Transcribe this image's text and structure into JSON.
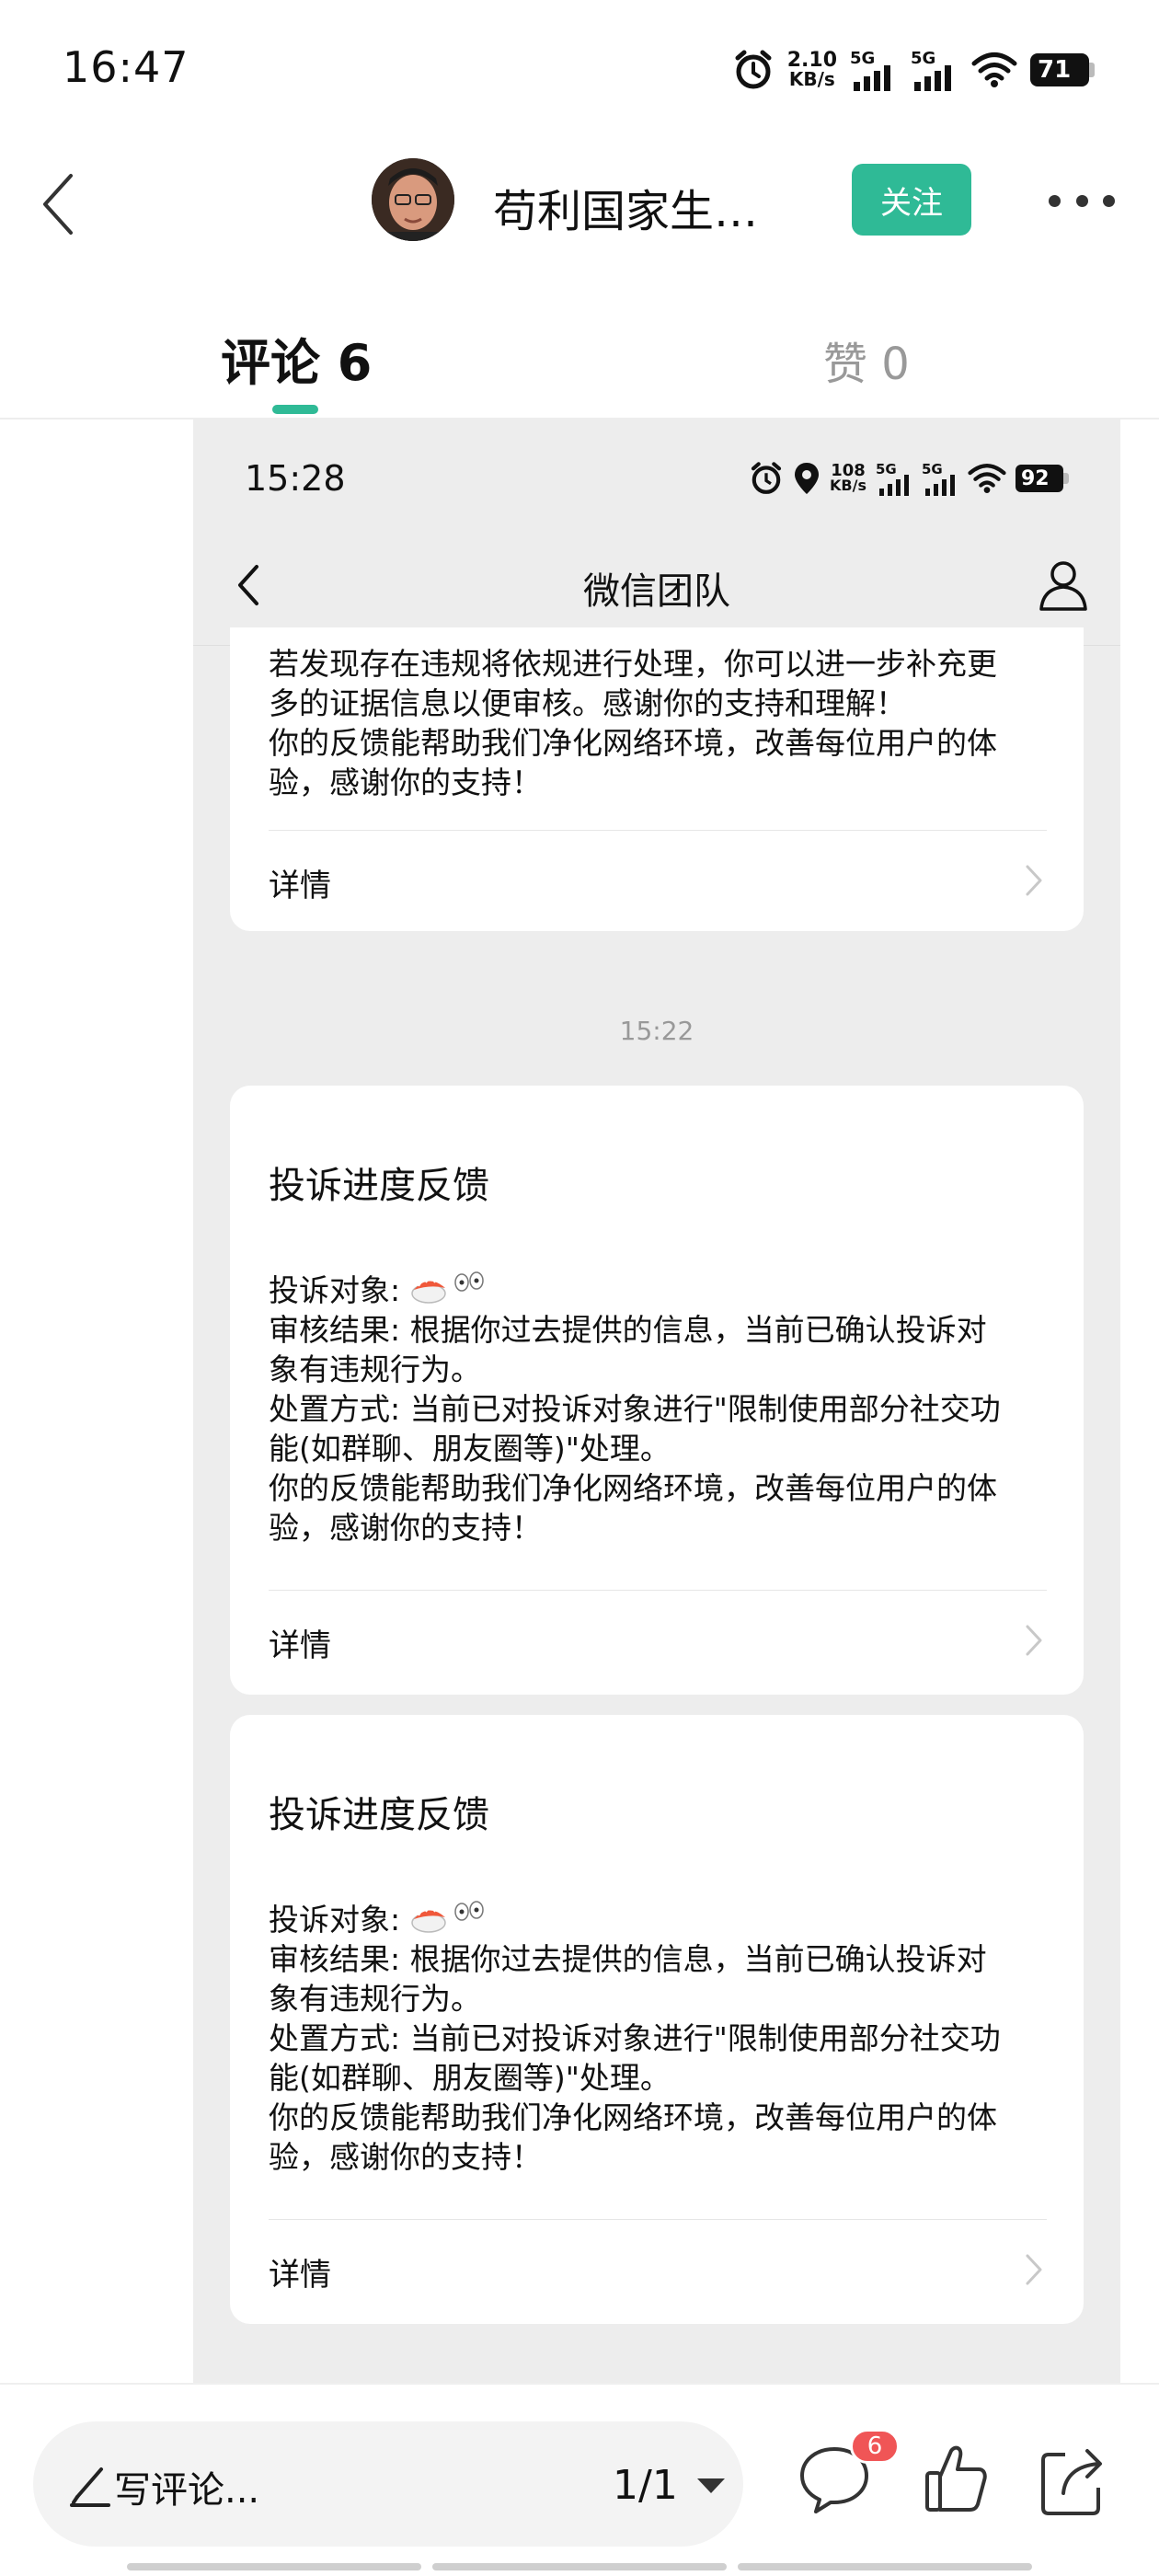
{
  "status_bar": {
    "time": "16:47",
    "net_speed": "2.10",
    "net_unit": "KB/s",
    "sig1_label": "5G",
    "sig2_label": "5G",
    "battery": "71"
  },
  "header": {
    "author_name": "苟利国家生…",
    "follow_label": "关注"
  },
  "tabs": {
    "comments": "评论 6",
    "likes": "赞 0",
    "accent": "#2fba96"
  },
  "embedded": {
    "status": {
      "time": "15:28",
      "net_speed": "108",
      "net_unit": "KB/s",
      "sig1_label": "5G",
      "sig2_label": "5G",
      "battery": "92"
    },
    "nav_title": "微信团队",
    "top_card": {
      "lines": [
        "若发现存在违规将依规进行处理，你可以进一步补充更",
        "多的证据信息以便审核。感谢你的支持和理解！",
        "你的反馈能帮助我们净化网络环境，改善每位用户的体",
        "验，感谢你的支持！"
      ],
      "detail_label": "详情"
    },
    "timestamp": "15:22",
    "cards": [
      {
        "title": "投诉进度反馈",
        "target_label": "投诉对象: ",
        "lines": [
          "审核结果: 根据你过去提供的信息，当前已确认投诉对",
          "象有违规行为。",
          "处置方式: 当前已对投诉对象进行\"限制使用部分社交功",
          "能(如群聊、朋友圈等)\"处理。",
          "你的反馈能帮助我们净化网络环境，改善每位用户的体",
          "验，感谢你的支持！"
        ],
        "detail_label": "详情"
      },
      {
        "title": "投诉进度反馈",
        "target_label": "投诉对象: ",
        "lines": [
          "审核结果: 根据你过去提供的信息，当前已确认投诉对",
          "象有违规行为。",
          "处置方式: 当前已对投诉对象进行\"限制使用部分社交功",
          "能(如群聊、朋友圈等)\"处理。",
          "你的反馈能帮助我们净化网络环境，改善每位用户的体",
          "验，感谢你的支持！"
        ],
        "detail_label": "详情"
      }
    ]
  },
  "bottom_bar": {
    "comment_placeholder": "写评论...",
    "page_indicator": "1/1",
    "comment_count": "6",
    "badge_color": "#f05556"
  }
}
